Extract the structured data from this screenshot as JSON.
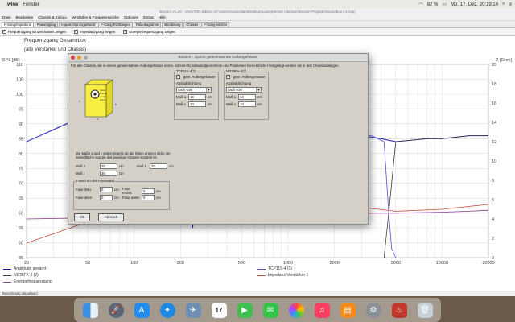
{
  "mac_menubar": {
    "app": "wine",
    "menu": "Fenster",
    "battery": "82 %",
    "clock": "Mo. 17. Dez. 20:19:16"
  },
  "window": {
    "title": "Boxsim V1.20 - VISATON-Edition (Z:\\Users\\maximilian\\Desktop\\Lautsprecher Literatur\\Boxsim Projekte\\Soundbox K1.bsp)",
    "menu": [
      "Datei",
      "Bearbeiten",
      "Chassis & Einbau",
      "Verstärker & Frequenzweiche",
      "Optionen",
      "Extras",
      "Hilfe"
    ],
    "tabs": [
      "F-Gang/Impedanz",
      "Phasengang",
      "Impuls-/Sprungantwort",
      "F-Gang Richtungen",
      "Polardiagramm",
      "Bündelung",
      "Chassis",
      "F-Gang einzeln"
    ],
    "options": [
      {
        "label": "Frequenzgang Einzelchassis zeigen",
        "checked": true
      },
      {
        "label": "Impedanzgang zeigen",
        "checked": true
      },
      {
        "label": "Energiefrequenzgang zeigen",
        "checked": true
      }
    ],
    "status": "Berechnung aktualisiert"
  },
  "chart_data": {
    "type": "line",
    "title": "Frequenzgang Gesamtbox",
    "subtitle": "(alle Verstärker und Chassis)",
    "ylabel_left": "SPL [dB]",
    "ylabel_right": "Z [Ohm]",
    "xlim": [
      20,
      20000
    ],
    "ylim": [
      45,
      110
    ],
    "x_scale": "log",
    "grid": true,
    "x_ticks": [
      "20",
      "50",
      "100",
      "200",
      "500",
      "1000",
      "2000",
      "5000",
      "10000",
      "20000"
    ],
    "y_ticks_left": [
      "110",
      "105",
      "100",
      "95",
      "90",
      "85",
      "80",
      "75",
      "70",
      "65",
      "60",
      "55",
      "50",
      "45"
    ],
    "y_ticks_right": [
      "20",
      "18",
      "16",
      "14",
      "12",
      "10",
      "8",
      "6",
      "4",
      "2",
      "0"
    ],
    "series": [
      {
        "name": "Amplitude gesamt",
        "color": "#1c1cab",
        "x": [
          20,
          40,
          70,
          100,
          150,
          200,
          220,
          240,
          260,
          400,
          1000,
          2000,
          3000,
          4000,
          5000,
          8000,
          10000,
          15000,
          20000
        ],
        "y": [
          84,
          91,
          94,
          95,
          96,
          96,
          92,
          55,
          85,
          86,
          87,
          86,
          86,
          85,
          84,
          85,
          85,
          86,
          86
        ]
      },
      {
        "name": "TCP115-4 (1)",
        "color": "#5050d0",
        "x": [
          20,
          50,
          100,
          200,
          220,
          240,
          500,
          1000,
          2000,
          3500,
          4200,
          4500,
          4700,
          5000
        ],
        "y": [
          84,
          93,
          95,
          96,
          92,
          56,
          86,
          87,
          86,
          86,
          84,
          60,
          48,
          45
        ]
      },
      {
        "name": "ND25FA-4 (2)",
        "color": "#3c3c3c",
        "x": [
          4200,
          4500,
          5000,
          8000,
          10000,
          15000,
          20000
        ],
        "y": [
          45,
          60,
          84,
          85,
          85,
          86,
          86
        ]
      },
      {
        "name": "Impedanz Verstärker 1",
        "color": "#c34836",
        "x": [
          20,
          50,
          80,
          100,
          200,
          500,
          1000,
          2000,
          3000,
          5000,
          10000,
          15000,
          20000
        ],
        "y": [
          1.5,
          3.7,
          4.7,
          4.4,
          4.0,
          4.5,
          5.2,
          5.4,
          5.2,
          4.8,
          5.0,
          5.3,
          5.5
        ]
      },
      {
        "name": "Energiefrequenzgang",
        "color": "#8c3a8c",
        "x": [
          20,
          100,
          200,
          500,
          1000,
          2000,
          5000,
          10000,
          15000,
          20000
        ],
        "y": [
          4.0,
          4.2,
          4.2,
          4.3,
          4.4,
          4.6,
          4.6,
          4.7,
          4.8,
          4.9
        ]
      }
    ]
  },
  "dialog": {
    "title": "Boxsim - Option gemeinsames Außengehäuse",
    "note": "Für alle Chassis, die in einem gemeinsamen Außengehäuse sitzen, können Schallwandgeometrien und Positionen hier einfacher festgelegt werden als in den Chassisdialogen.",
    "illustration_text": [
      "Seite",
      "Schall-",
      "wand",
      "oben"
    ],
    "illu_labels": {
      "c": "c",
      "a": "a",
      "b": "b"
    },
    "note2": "Die Maße a und c geben jeweils ab der linken unteren Ecke der Seitenfläche aus die das jeweilige Chassis montiert ist.",
    "fields": {
      "mass_h_label": "Maß h",
      "mass_h_value": "30",
      "mass_h_unit": "cm",
      "mass_b_label": "Maß b",
      "mass_b_value": "20",
      "mass_b_unit": "cm",
      "mass_t_label": "Maß t",
      "mass_t_value": "30",
      "mass_t_unit": "cm"
    },
    "fasen": {
      "heading": "Fasen an der Frontwand",
      "links_label": "Fase links",
      "links_value": "0",
      "links_unit": "cm",
      "rechts_label": "Fase rechts",
      "rechts_value": "0",
      "rechts_unit": "cm",
      "oben_label": "Fase oben",
      "oben_value": "0",
      "oben_unit": "cm",
      "unten_label": "Fase unten",
      "unten_value": "0",
      "unten_unit": "cm"
    },
    "chassis": [
      {
        "name": "TCP115-4(1)",
        "checkbox_label": "gem. Außengehäuse",
        "abstrahl_label": "Abstrahlrichtung",
        "direction": "nach vorn",
        "a_label": "Maß a",
        "a_value": "10",
        "c_label": "Maß c",
        "c_value": "10",
        "unit": "cm"
      },
      {
        "name": "ND25FA-4(2)",
        "checkbox_label": "gem. Außengehäuse",
        "abstrahl_label": "Abstrahlrichtung",
        "direction": "nach vorn",
        "a_label": "Maß a",
        "a_value": "14",
        "c_label": "Maß c",
        "c_value": "10",
        "unit": "cm"
      }
    ],
    "ok_label": "Ok",
    "cancel_label": "Abbruch"
  },
  "dock": {
    "icons": [
      "finder-icon",
      "launchpad-icon",
      "app-store-icon",
      "safari-icon",
      "preview-icon",
      "calendar-icon",
      "facetime-icon",
      "messages-icon",
      "photos-icon",
      "music-icon",
      "books-icon",
      "system-preferences-icon",
      "wine-icon",
      "trash-icon"
    ],
    "calendar_day": "17"
  }
}
